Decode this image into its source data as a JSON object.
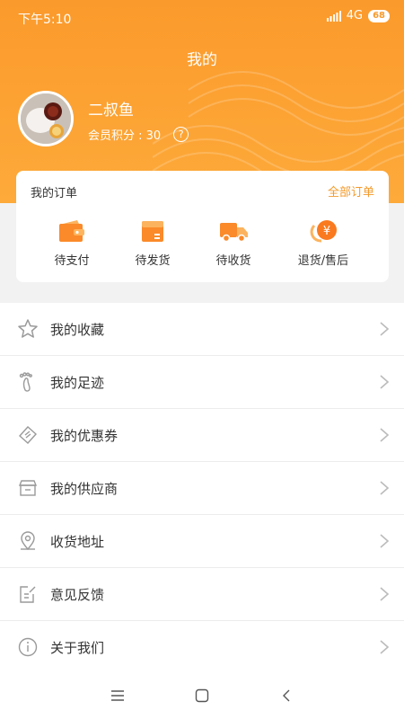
{
  "status_bar": {
    "time": "下午5:10",
    "network": "4G",
    "battery": "68"
  },
  "header": {
    "title": "我的"
  },
  "profile": {
    "name": "二叔鱼",
    "points_label": "会员积分 : 30",
    "help_icon": "question-circle-icon"
  },
  "orders": {
    "title": "我的订单",
    "all_link": "全部订单",
    "items": [
      {
        "label": "待支付",
        "icon": "wallet-icon"
      },
      {
        "label": "待发货",
        "icon": "box-icon"
      },
      {
        "label": "待收货",
        "icon": "truck-icon"
      },
      {
        "label": "退货/售后",
        "icon": "refund-yen-icon"
      }
    ]
  },
  "menu": [
    {
      "label": "我的收藏",
      "icon": "star-icon"
    },
    {
      "label": "我的足迹",
      "icon": "footprint-icon"
    },
    {
      "label": "我的优惠券",
      "icon": "coupon-icon"
    },
    {
      "label": "我的供应商",
      "icon": "store-icon"
    },
    {
      "label": "收货地址",
      "icon": "location-pin-icon"
    },
    {
      "label": "意见反馈",
      "icon": "feedback-icon"
    },
    {
      "label": "关于我们",
      "icon": "info-icon"
    }
  ],
  "colors": {
    "accent": "#fb9a2c",
    "accent_text": "#f39a2a",
    "icon_gray": "#9a9a9a"
  }
}
